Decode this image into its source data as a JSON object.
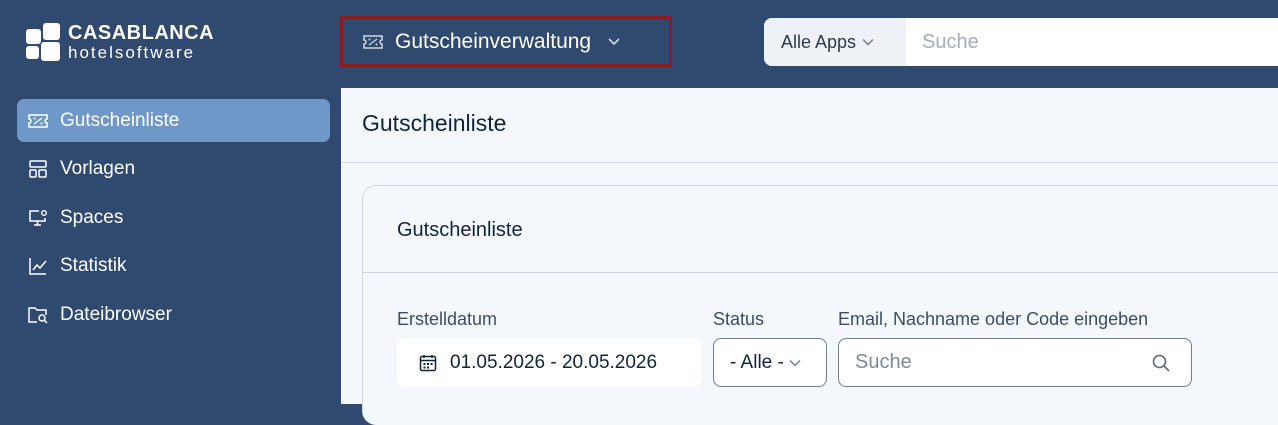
{
  "brand": {
    "line1": "CASABLANCA",
    "line2": "hotelsoftware"
  },
  "app_switcher": {
    "icon": "ticket-icon",
    "label": "Gutscheinverwaltung"
  },
  "global_search": {
    "scope_label": "Alle Apps",
    "placeholder": "Suche"
  },
  "sidebar": {
    "items": [
      {
        "label": "Gutscheinliste",
        "icon": "ticket-icon",
        "active": true
      },
      {
        "label": "Vorlagen",
        "icon": "layout-icon",
        "active": false
      },
      {
        "label": "Spaces",
        "icon": "monitor-gear-icon",
        "active": false
      },
      {
        "label": "Statistik",
        "icon": "line-chart-icon",
        "active": false
      },
      {
        "label": "Dateibrowser",
        "icon": "folder-search-icon",
        "active": false
      }
    ]
  },
  "page": {
    "title": "Gutscheinliste"
  },
  "card": {
    "title": "Gutscheinliste",
    "filters": {
      "date_label": "Erstelldatum",
      "date_value": "01.05.2026 - 20.05.2026",
      "status_label": "Status",
      "status_value": "- Alle -",
      "search_label": "Email, Nachname oder Code eingeben",
      "search_placeholder": "Suche"
    }
  },
  "colors": {
    "navy": "#2f4a6e",
    "active_nav": "#6f98c8",
    "highlight_border": "#8a1c24",
    "content_bg": "#f4f7fb"
  }
}
